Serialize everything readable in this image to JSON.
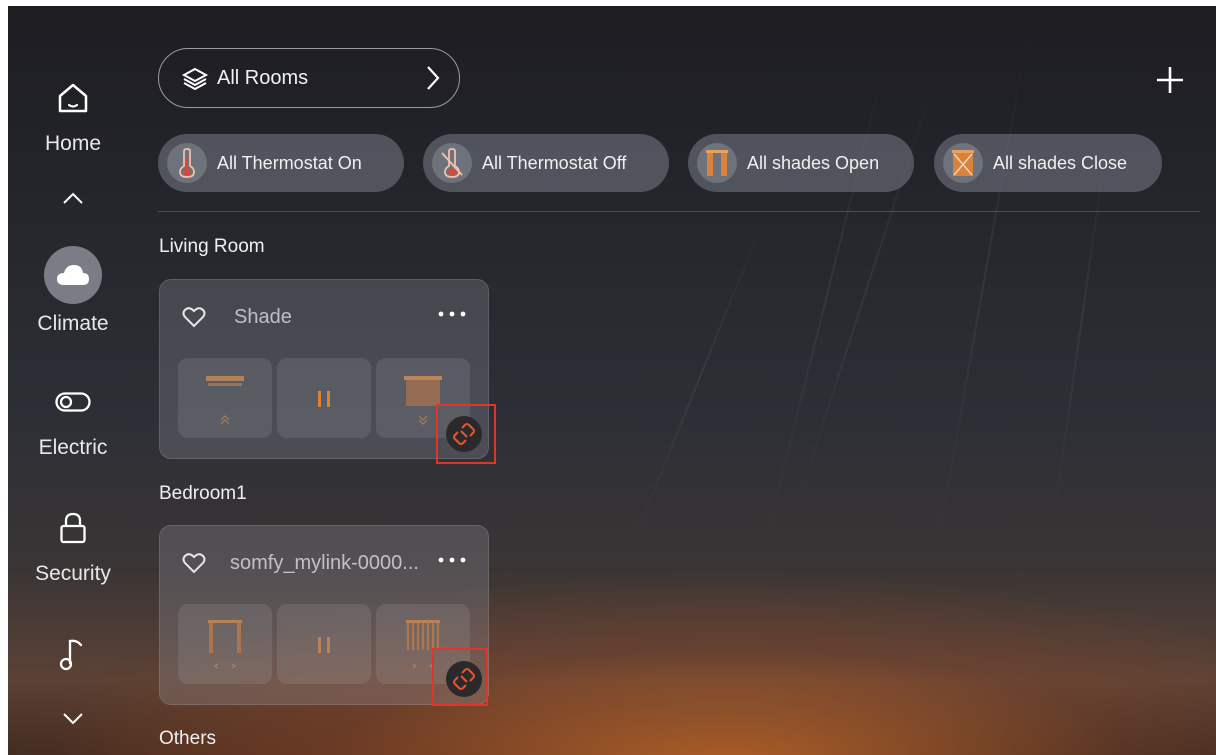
{
  "sidebar": {
    "items": [
      {
        "label": "Home",
        "icon": "home-icon"
      },
      {
        "label": "Climate",
        "icon": "cloud-icon"
      },
      {
        "label": "Electric",
        "icon": "toggle-icon"
      },
      {
        "label": "Security",
        "icon": "lock-icon"
      },
      {
        "label": "",
        "icon": "music-note-icon"
      }
    ]
  },
  "header": {
    "rooms_label": "All Rooms"
  },
  "quick_actions": [
    {
      "label": "All Thermostat On",
      "icon": "thermometer-icon"
    },
    {
      "label": "All Thermostat Off",
      "icon": "thermometer-off-icon"
    },
    {
      "label": "All shades Open",
      "icon": "shade-open-icon"
    },
    {
      "label": "All shades Close",
      "icon": "shade-close-icon"
    }
  ],
  "sections": [
    {
      "title": "Living Room",
      "device": {
        "name": "Shade"
      }
    },
    {
      "title": "Bedroom1",
      "device": {
        "name": "somfy_mylink-0000..."
      }
    },
    {
      "title": "Others"
    }
  ],
  "colors": {
    "accent": "#d9823b",
    "highlight": "#e0362a"
  }
}
